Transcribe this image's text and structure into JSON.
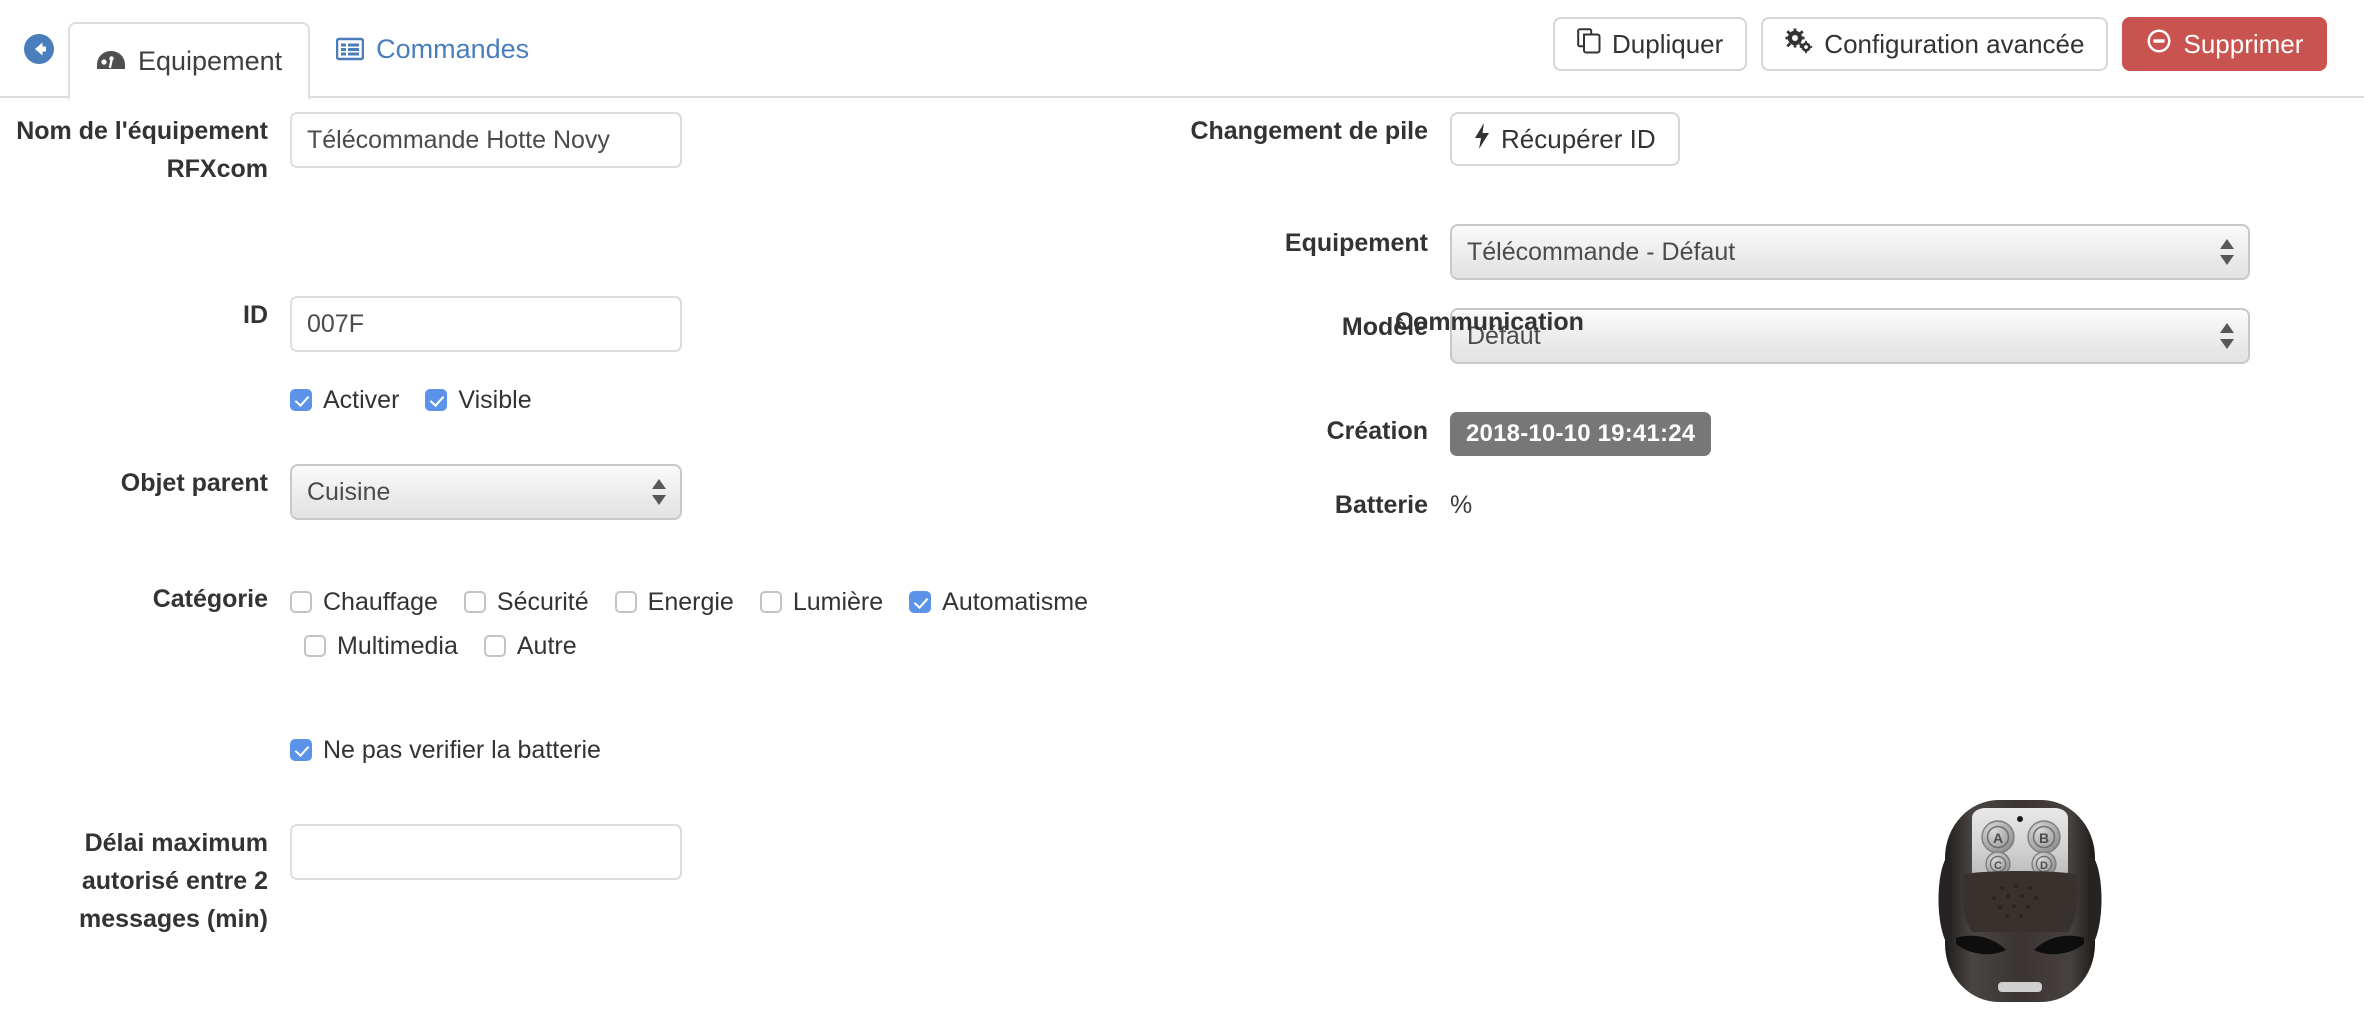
{
  "nav": {
    "back_icon": "circle-arrow-left-icon",
    "tabs": [
      {
        "label": "Equipement",
        "icon": "dashboard-icon",
        "active": true
      },
      {
        "label": "Commandes",
        "icon": "list-alt-icon",
        "active": false
      }
    ]
  },
  "toolbar": {
    "duplicate_label": "Dupliquer",
    "duplicate_icon": "copy-icon",
    "advanced_label": "Configuration avancée",
    "advanced_icon": "cogs-icon",
    "delete_label": "Supprimer",
    "delete_icon": "minus-circle-icon",
    "danger_color": "#c9534f"
  },
  "left": {
    "name_label": "Nom de l'équipement RFXcom",
    "name_value": "Télécommande Hotte Novy",
    "id_label": "ID",
    "id_value": "007F",
    "enable_label": "Activer",
    "enable_checked": true,
    "visible_label": "Visible",
    "visible_checked": true,
    "parent_label": "Objet parent",
    "parent_value": "Cuisine",
    "category_label": "Catégorie",
    "categories": [
      {
        "label": "Chauffage",
        "checked": false
      },
      {
        "label": "Sécurité",
        "checked": false
      },
      {
        "label": "Energie",
        "checked": false
      },
      {
        "label": "Lumière",
        "checked": false
      },
      {
        "label": "Automatisme",
        "checked": true
      },
      {
        "label": "Multimedia",
        "checked": false
      },
      {
        "label": "Autre",
        "checked": false
      }
    ],
    "nobattery_label": "Ne pas verifier la batterie",
    "nobattery_checked": true,
    "delay_label": "Délai maximum autorisé entre 2 messages (min)",
    "delay_value": "",
    "delay_placeholder": ""
  },
  "right": {
    "battery_change_label": "Changement de pile",
    "recover_id_label": "Récupérer ID",
    "recover_id_icon": "bolt-icon",
    "equipment_label": "Equipement",
    "equipment_value": "Télécommande - Défaut",
    "model_label": "Modèle",
    "model_value": "Défaut",
    "creation_label": "Création",
    "creation_value": "2018-10-10 19:41:24",
    "communication_label": "Communication",
    "battery_label": "Batterie",
    "battery_value": "%",
    "device_image": "remote-control-keyfob-image",
    "remote_buttons": [
      "A",
      "B",
      "C",
      "D"
    ]
  },
  "colors": {
    "accent_blue": "#4a7dbb",
    "checkbox_blue": "#5b93e8",
    "badge_gray": "#777777",
    "danger_red": "#c9534f"
  }
}
